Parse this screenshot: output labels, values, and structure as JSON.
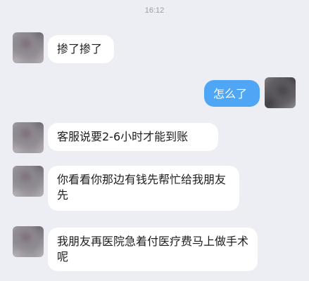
{
  "status": {
    "time": "16:12"
  },
  "messages": [
    {
      "sender": "contact",
      "text": "掺了掺了"
    },
    {
      "sender": "me",
      "text": "怎么了"
    },
    {
      "sender": "contact",
      "text": "客服说要2-6小时才能到账"
    },
    {
      "sender": "contact",
      "text": "你看看你那边有钱先帮忙给我朋友先"
    },
    {
      "sender": "contact",
      "text": "我朋友再医院急着付医疗费马上做手术呢"
    }
  ],
  "colors": {
    "background": "#eceef3",
    "incoming_bubble": "#ffffff",
    "outgoing_bubble": "#4fa6f5"
  }
}
